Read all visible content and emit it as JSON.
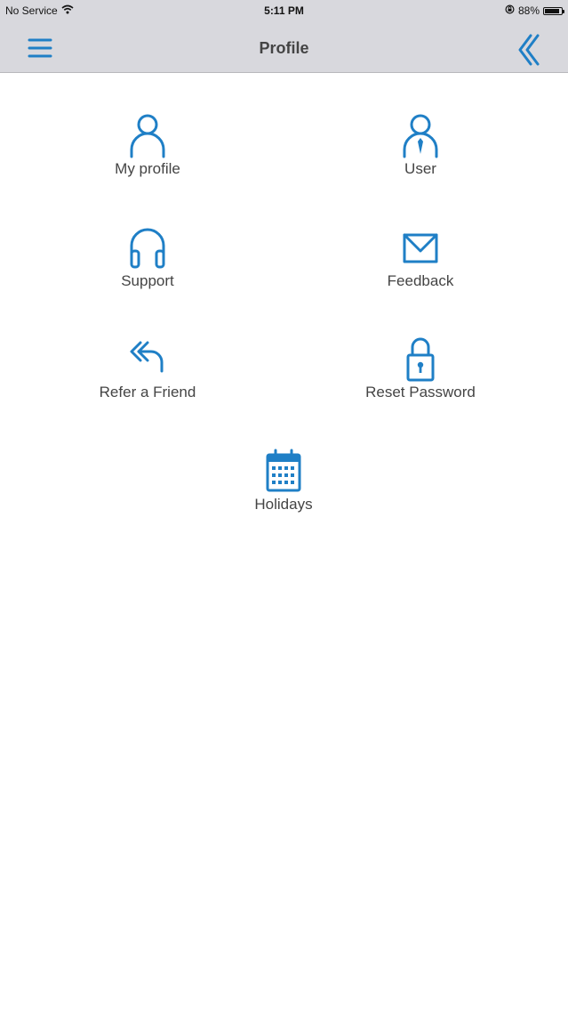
{
  "status_bar": {
    "carrier": "No Service",
    "time": "5:11 PM",
    "battery_percent": "88%",
    "battery_level": 0.88
  },
  "nav": {
    "title": "Profile",
    "menu_icon": "hamburger-menu-icon",
    "back_icon": "double-chevron-left-icon"
  },
  "menu": {
    "items": [
      {
        "label": "My profile",
        "icon": "person-icon"
      },
      {
        "label": "User",
        "icon": "person-tie-icon"
      },
      {
        "label": "Support",
        "icon": "headphones-icon"
      },
      {
        "label": "Feedback",
        "icon": "envelope-icon"
      },
      {
        "label": "Refer a Friend",
        "icon": "reply-all-icon"
      },
      {
        "label": "Reset Password",
        "icon": "lock-icon"
      },
      {
        "label": "Holidays",
        "icon": "calendar-icon"
      }
    ]
  },
  "colors": {
    "accent": "#1f7fc6",
    "bar_background": "#d8d8dd"
  }
}
